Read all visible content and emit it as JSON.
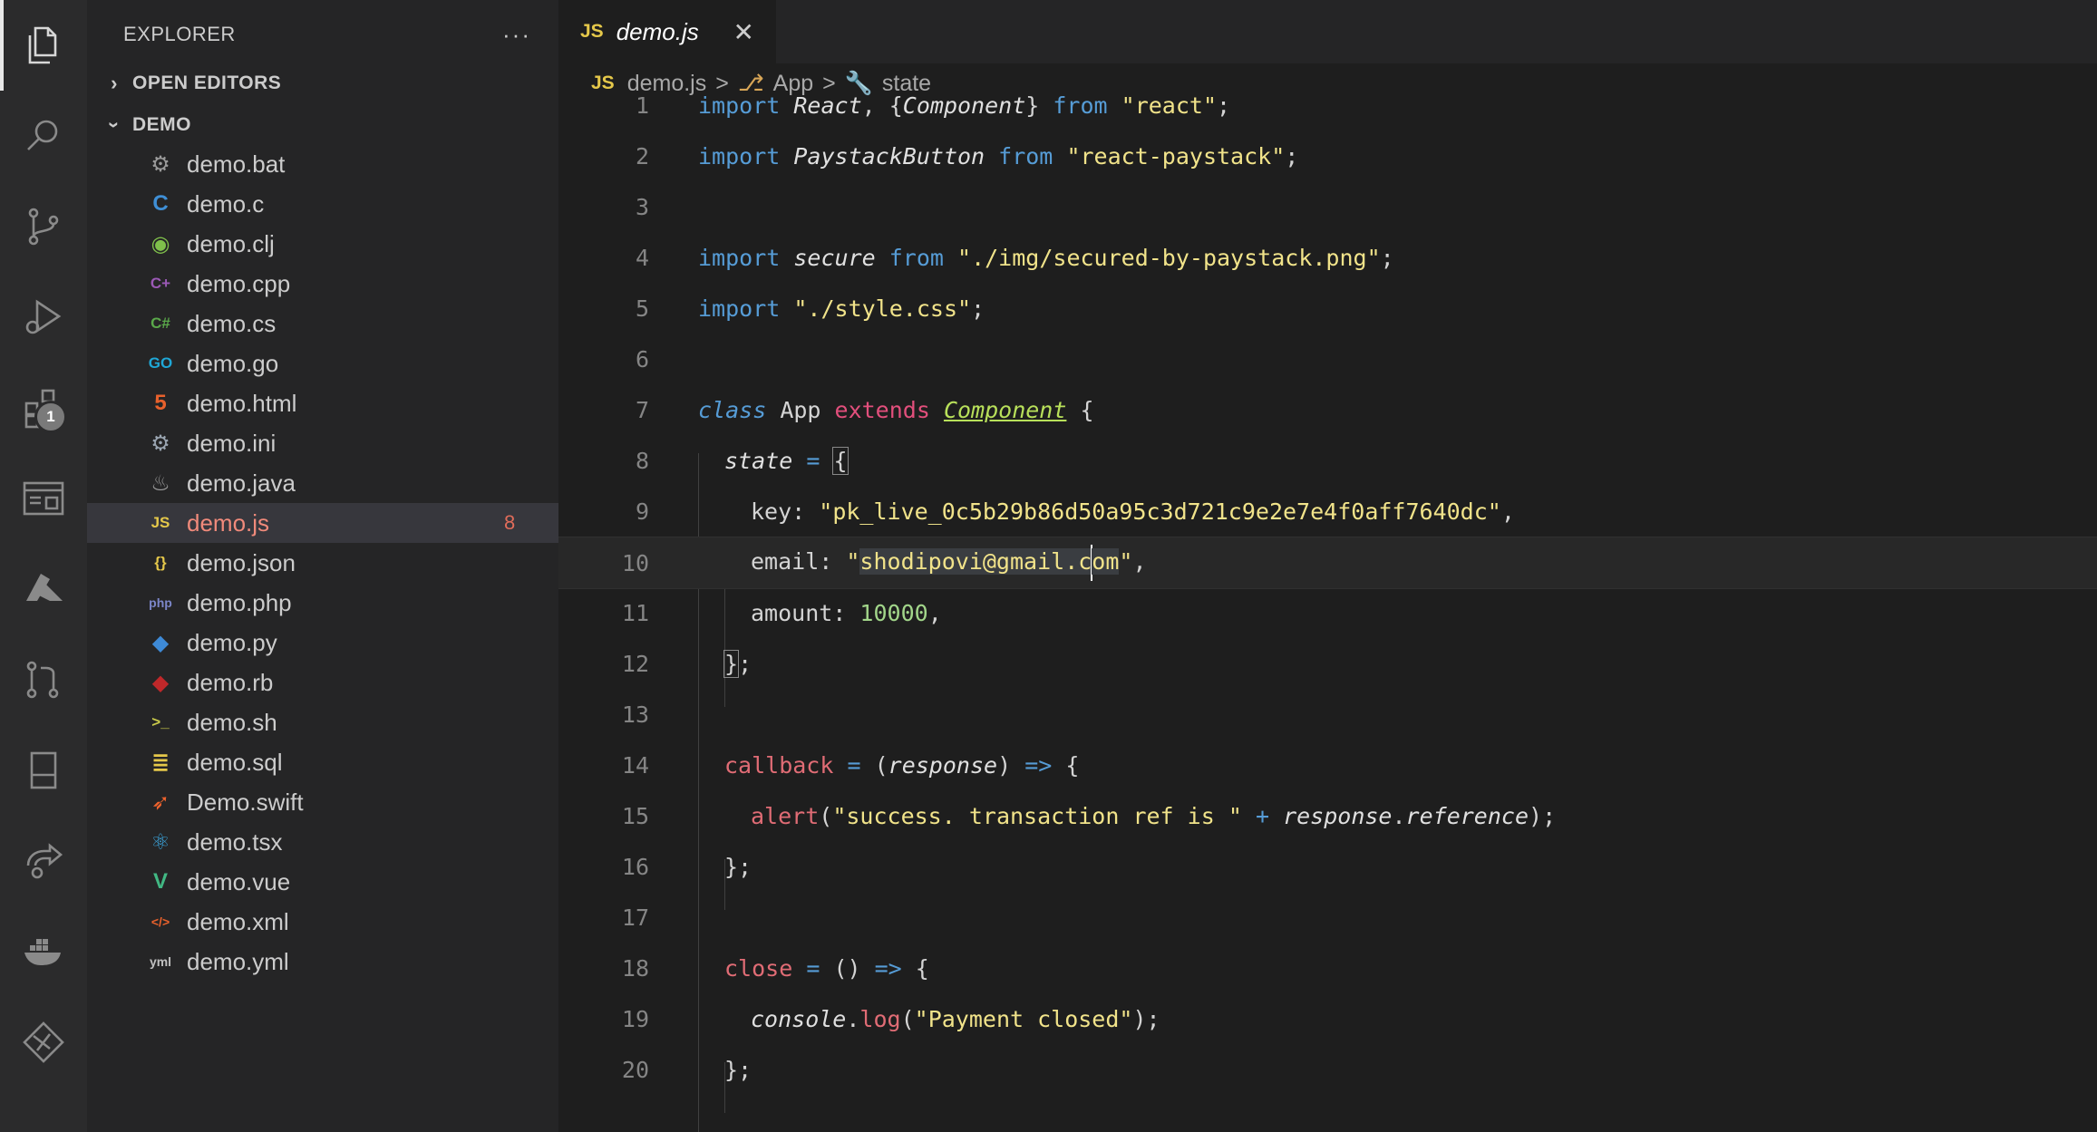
{
  "explorer": {
    "title": "EXPLORER",
    "more": "···",
    "open_editors": "OPEN EDITORS",
    "folder": "DEMO",
    "files": [
      {
        "name": "demo.bat",
        "icon": "gear-cog-icon",
        "color": "#9a9a9a",
        "glyph": "⚙"
      },
      {
        "name": "demo.c",
        "icon": "c-lang-icon",
        "color": "#3f8fd6",
        "glyph": "C"
      },
      {
        "name": "demo.clj",
        "icon": "clojure-icon",
        "color": "#7fbf4b",
        "glyph": "◉"
      },
      {
        "name": "demo.cpp",
        "icon": "cpp-icon",
        "color": "#9b59b6",
        "glyph": "C+"
      },
      {
        "name": "demo.cs",
        "icon": "csharp-icon",
        "color": "#5aa84a",
        "glyph": "C#"
      },
      {
        "name": "demo.go",
        "icon": "go-icon",
        "color": "#1fa7d6",
        "glyph": "GO"
      },
      {
        "name": "demo.html",
        "icon": "html5-icon",
        "color": "#e8612c",
        "glyph": "5"
      },
      {
        "name": "demo.ini",
        "icon": "settings-gear-icon",
        "color": "#9aa5b1",
        "glyph": "⚙"
      },
      {
        "name": "demo.java",
        "icon": "java-icon",
        "color": "#a0a0a0",
        "glyph": "♨"
      },
      {
        "name": "demo.js",
        "icon": "js-icon",
        "color": "#e5c84a",
        "glyph": "JS",
        "count": "8",
        "selected": true
      },
      {
        "name": "demo.json",
        "icon": "json-icon",
        "color": "#e5c84a",
        "glyph": "{}"
      },
      {
        "name": "demo.php",
        "icon": "php-icon",
        "color": "#7b86c8",
        "glyph": "php"
      },
      {
        "name": "demo.py",
        "icon": "python-icon",
        "color": "#3e8ad6",
        "glyph": "◆"
      },
      {
        "name": "demo.rb",
        "icon": "ruby-icon",
        "color": "#c0282a",
        "glyph": "◆"
      },
      {
        "name": "demo.sh",
        "icon": "terminal-icon",
        "color": "#c9c94a",
        "glyph": ">_"
      },
      {
        "name": "demo.sql",
        "icon": "database-icon",
        "color": "#e5c84a",
        "glyph": "≣"
      },
      {
        "name": "Demo.swift",
        "icon": "swift-icon",
        "color": "#f0632d",
        "glyph": "➶"
      },
      {
        "name": "demo.tsx",
        "icon": "react-icon",
        "color": "#3aa0d6",
        "glyph": "⚛"
      },
      {
        "name": "demo.vue",
        "icon": "vue-icon",
        "color": "#41b883",
        "glyph": "V"
      },
      {
        "name": "demo.xml",
        "icon": "xml-icon",
        "color": "#e8612c",
        "glyph": "</>"
      },
      {
        "name": "demo.yml",
        "icon": "yaml-icon",
        "color": "#c0c0c0",
        "glyph": "yml"
      }
    ]
  },
  "tab": {
    "badge": "JS",
    "label": "demo.js",
    "close": "✕"
  },
  "breadcrumb": {
    "badge": "JS",
    "file": "demo.js",
    "symbol1": "App",
    "symbol2": "state",
    "sep": ">"
  },
  "activity": {
    "extensions_badge": "1"
  },
  "line_numbers": [
    "1",
    "2",
    "3",
    "4",
    "5",
    "6",
    "7",
    "8",
    "9",
    "10",
    "11",
    "12",
    "13",
    "14",
    "15",
    "16",
    "17",
    "18",
    "19",
    "20"
  ],
  "code": {
    "l1": {
      "kw": "import",
      "a": " ",
      "b": "React",
      "c": ", {",
      "d": "Component",
      "e": "} ",
      "f": "from",
      "g": " ",
      "h": "\"react\"",
      "i": ";"
    },
    "l2": {
      "kw": "import",
      "a": " ",
      "b": "PaystackButton",
      "c": " ",
      "d": "from",
      "e": " ",
      "f": "\"react-paystack\"",
      "g": ";"
    },
    "l4": {
      "kw": "import",
      "a": " ",
      "b": "secure",
      "c": " ",
      "d": "from",
      "e": " ",
      "f": "\"./img/secured-by-paystack.png\"",
      "g": ";"
    },
    "l5": {
      "kw": "import",
      "a": " ",
      "f": "\"./style.css\"",
      "g": ";"
    },
    "l7": {
      "a": "class",
      "b": " App ",
      "c": "extends",
      "d": " ",
      "e": "Component",
      "f": " {"
    },
    "l8": {
      "a": "state",
      "b": " ",
      "c": "=",
      "d": " ",
      "e": "{"
    },
    "l9": {
      "a": "key: ",
      "b": "\"pk_live_0c5b29b86d50a95c3d721c9e2e7e4f0aff7640dc\"",
      "c": ","
    },
    "l10": {
      "a": "email: ",
      "b": "\"",
      "c": "shodipovi@gmail.c",
      "d": "om",
      "e": "\"",
      "f": ","
    },
    "l11": {
      "a": "amount: ",
      "b": "10000",
      "c": ","
    },
    "l12": {
      "a": "}",
      "b": ";"
    },
    "l14": {
      "a": "callback",
      "b": " ",
      "c": "=",
      "d": " (",
      "e": "response",
      "f": ") ",
      "g": "=>",
      "h": " {"
    },
    "l15": {
      "a": "alert",
      "b": "(",
      "c": "\"success. transaction ref is \"",
      "d": " ",
      "e": "+",
      "f": " ",
      "g": "response",
      "h": ".",
      "i": "reference",
      "j": ");"
    },
    "l16": {
      "a": "};"
    },
    "l18": {
      "a": "close",
      "b": " ",
      "c": "=",
      "d": " () ",
      "e": "=>",
      "f": " {"
    },
    "l19": {
      "a": "console",
      "b": ".",
      "c": "log",
      "d": "(",
      "e": "\"Payment closed\"",
      "f": ");"
    },
    "l20": {
      "a": "};"
    }
  }
}
